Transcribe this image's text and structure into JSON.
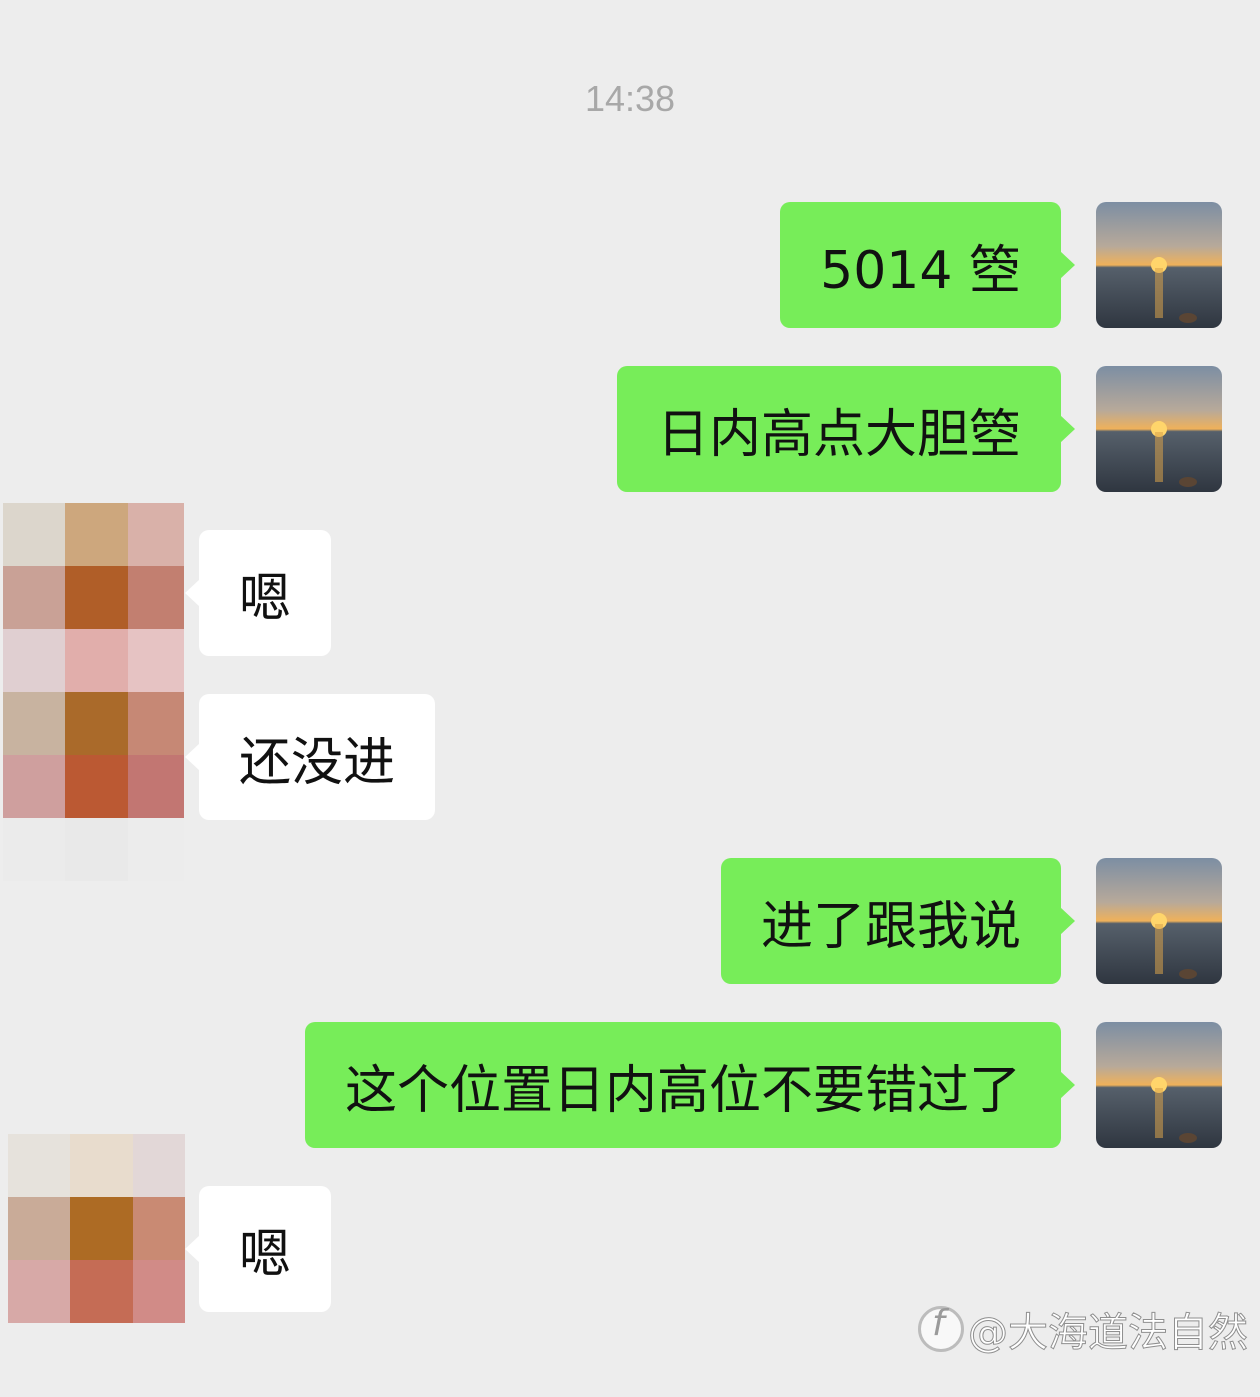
{
  "chat": {
    "timestamp": "14:38",
    "messages": [
      {
        "from": "me",
        "text": "5014 箜"
      },
      {
        "from": "me",
        "text": "日内高点大胆箜"
      },
      {
        "from": "them",
        "text": "嗯"
      },
      {
        "from": "them",
        "text": "还没进"
      },
      {
        "from": "me",
        "text": "进了跟我说"
      },
      {
        "from": "me",
        "text": "这个位置日内高位不要错过了"
      },
      {
        "from": "them",
        "text": "嗯"
      }
    ]
  },
  "avatars": {
    "me": "sunset-over-sea",
    "them": "pixelated-mosaic"
  },
  "colors": {
    "background": "#ededed",
    "outgoing_bubble": "#77ed59",
    "incoming_bubble": "#ffffff",
    "timestamp": "#a8a8a8"
  },
  "watermark": {
    "text": "@大海道法自然"
  }
}
